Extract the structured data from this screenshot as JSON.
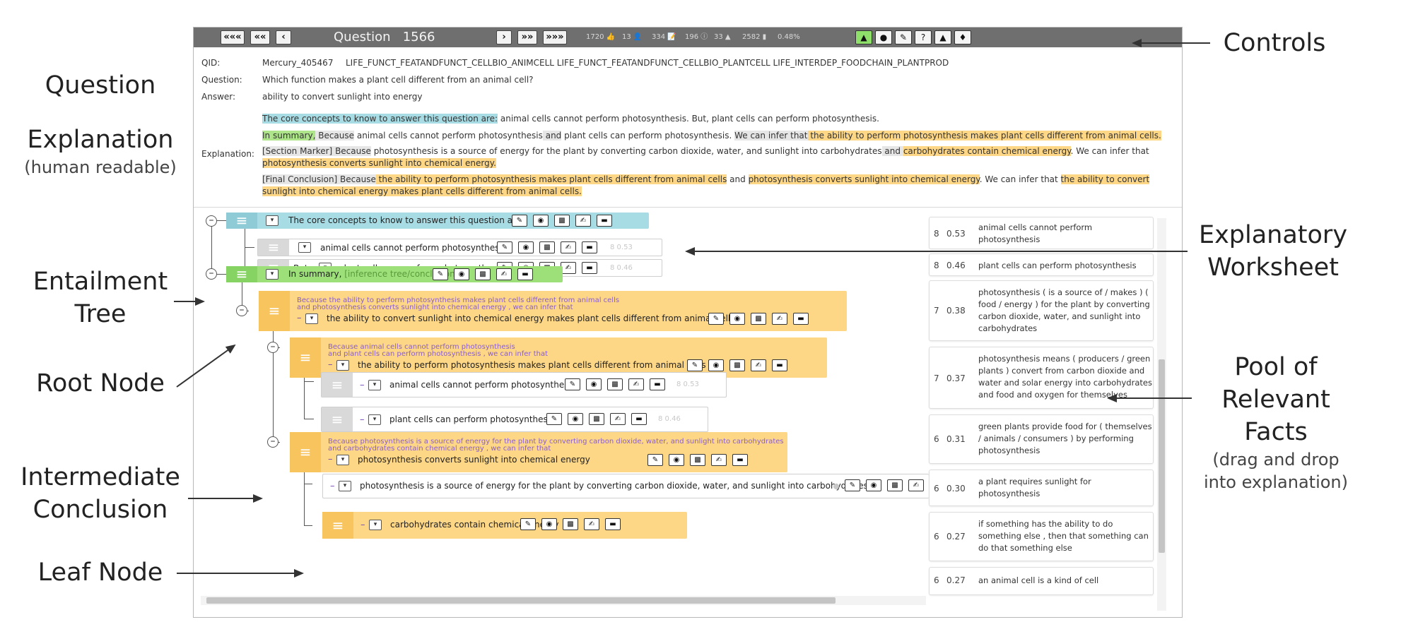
{
  "annotations": {
    "controls": "Controls",
    "question": "Question",
    "explanation": "Explanation",
    "explanation_sub": "(human readable)",
    "worksheet_1": "Explanatory",
    "worksheet_2": "Worksheet",
    "entailment_1": "Entailment",
    "entailment_2": "Tree",
    "root": "Root Node",
    "pool_1": "Pool of",
    "pool_2": "Relevant Facts",
    "pool_sub_1": "(drag and drop",
    "pool_sub_2": "into explanation)",
    "intermediate_1": "Intermediate",
    "intermediate_2": "Conclusion",
    "leaf": "Leaf Node"
  },
  "toolbar": {
    "first": "«««",
    "prev_big": "««",
    "prev": "‹",
    "question_label": "Question",
    "question_number": "1566",
    "next": "›",
    "next_big": "»»",
    "last": "»»»",
    "stats": [
      "1720 👍",
      "13 👤",
      "334 📝",
      "196 ⓘ",
      "33 ▲",
      "2582 ▮",
      "0.48%"
    ],
    "icon_buttons": [
      "thumbs-up",
      "user",
      "edit",
      "help",
      "warning",
      "bell"
    ]
  },
  "question": {
    "qid_label": "QID:",
    "qid": "Mercury_405467",
    "categories": "LIFE_FUNCT_FEATANDFUNCT_CELLBIO_ANIMCELL LIFE_FUNCT_FEATANDFUNCT_CELLBIO_PLANTCELL LIFE_INTERDEP_FOODCHAIN_PLANTPROD",
    "question_label": "Question:",
    "question_text": "Which function makes a plant cell different from an animal cell?",
    "answer_label": "Answer:",
    "answer_text": "ability to convert sunlight into energy",
    "explanation_label": "Explanation:"
  },
  "explanation": {
    "p1_a": "The core concepts to know to answer this question are:",
    "p1_b": " animal cells cannot perform photosynthesis. But, plant cells can perform photosynthesis.",
    "p2_a": "In summary,",
    "p2_b": " Because",
    "p2_c": " animal cells cannot perform photosynthesis",
    "p2_d": " and",
    "p2_e": " plant cells can perform photosynthesis. ",
    "p2_f": "We can infer that",
    "p2_g": " the ability to perform photosynthesis makes plant cells different from animal cells.",
    "p3_a": "[Section Marker]",
    "p3_b": " Because",
    "p3_c": " photosynthesis is a source of energy for the plant by converting carbon dioxide, water, and sunlight into carbohydrates",
    "p3_d": " and ",
    "p3_e": "carbohydrates contain chemical energy",
    "p3_f": ". We can infer that ",
    "p3_g": "photosynthesis converts sunlight into chemical energy.",
    "p4_a": "[Final Conclusion]",
    "p4_b": " Because",
    "p4_c": " the ability to perform photosynthesis makes plant cells different from animal cells",
    "p4_d": " and ",
    "p4_e": "photosynthesis converts sunlight into chemical energy",
    "p4_f": ". We can infer that ",
    "p4_g": "the ability to convert sunlight into chemical energy makes plant cells different from animal cells."
  },
  "tree": {
    "core_header": "The core concepts to know to answer this question are:",
    "leaf_animal": "animal cells cannot perform photosynthesis",
    "leaf_animal_score": "8  0.53",
    "but": "But,",
    "leaf_plant": "plant cells can perform photosynthesis",
    "leaf_plant_score": "8  0.46",
    "summary_a": "In summary,",
    "summary_b": "[inference tree/conclusion]",
    "root_sub1": "Because the ability to perform photosynthesis makes plant cells different from animal cells",
    "root_sub2": "and photosynthesis converts sunlight into chemical energy , we can infer that",
    "root_text": "the ability to convert sunlight into chemical energy makes plant cells different from animal cells",
    "inter1_sub1": "Because animal cells cannot perform photosynthesis",
    "inter1_sub2": "and plant cells can perform photosynthesis , we can infer that",
    "inter1_text": "the ability to perform photosynthesis makes plant cells different from animal cells",
    "leaf2_animal": "animal cells cannot perform photosynthesis",
    "leaf2_animal_score": "8  0.53",
    "leaf2_plant": "plant cells can perform photosynthesis",
    "leaf2_plant_score": "8  0.46",
    "inter2_sub1": "Because photosynthesis is a source of energy for the plant by converting carbon dioxide, water, and sunlight into carbohydrates",
    "inter2_sub2": "and carbohydrates contain chemical energy , we can infer that",
    "inter2_text": "photosynthesis converts sunlight into chemical energy",
    "leaf_source": "photosynthesis is a source of energy for the plant by converting carbon dioxide, water, and sunlight into carbohydrates",
    "leaf_carbs": "carbohydrates contain chemical energy",
    "dash": "–",
    "select": "▾",
    "handle": "≡"
  },
  "pool": [
    {
      "count": "8",
      "score": "0.53",
      "text": "animal cells cannot perform photosynthesis"
    },
    {
      "count": "8",
      "score": "0.46",
      "text": "plant cells can perform photosynthesis"
    },
    {
      "count": "7",
      "score": "0.38",
      "text": "photosynthesis ( is a source of / makes ) ( food / energy ) for the plant by converting carbon dioxide, water, and sunlight into carbohydrates"
    },
    {
      "count": "7",
      "score": "0.37",
      "text": "photosynthesis means ( producers / green plants ) convert from carbon dioxide and water and solar energy into carbohydrates and food and oxygen for themselves"
    },
    {
      "count": "6",
      "score": "0.31",
      "text": "green plants provide food for ( themselves / animals / consumers ) by performing photosynthesis"
    },
    {
      "count": "6",
      "score": "0.30",
      "text": "a plant requires sunlight for photosynthesis"
    },
    {
      "count": "6",
      "score": "0.27",
      "text": "if something has the ability to do something else , then that something can do that something else"
    },
    {
      "count": "6",
      "score": "0.27",
      "text": "an animal cell is a kind of cell"
    }
  ],
  "colors": {
    "toolbar": "#6f6f6f",
    "core_blue": "#a8dce4",
    "summary_green": "#9de07a",
    "conclusion_orange": "#fdd686",
    "leaf_gray": "#d9d9d9",
    "sub_purple": "#8a5fc8"
  }
}
